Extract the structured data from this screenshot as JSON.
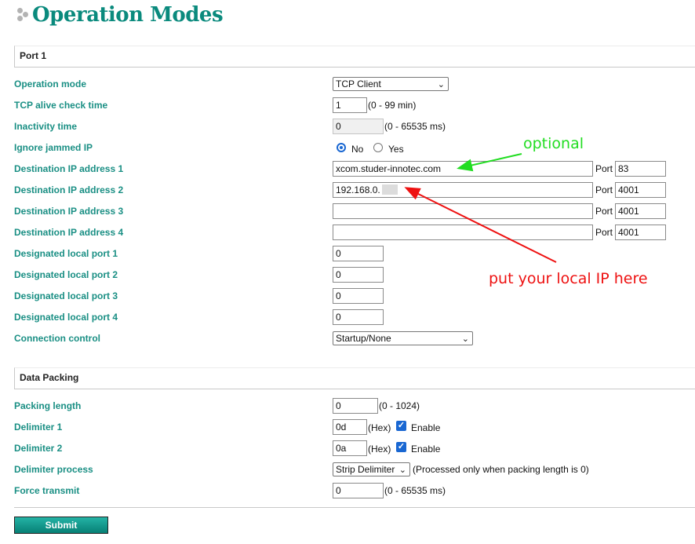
{
  "page": {
    "title": "Operation Modes"
  },
  "port_section": {
    "title": "Port 1",
    "rows": {
      "operation_mode": {
        "label": "Operation mode",
        "value": "TCP Client"
      },
      "tcp_alive": {
        "label": "TCP alive check time",
        "value": "1",
        "hint": "(0 - 99 min)"
      },
      "inactivity": {
        "label": "Inactivity time",
        "value": "0",
        "hint": "(0 - 65535 ms)"
      },
      "ignore_jammed": {
        "label": "Ignore jammed IP",
        "option_no": "No",
        "option_yes": "Yes",
        "selected": "No"
      },
      "dest1": {
        "label": "Destination IP address 1",
        "value": "xcom.studer-innotec.com",
        "port_label": "Port",
        "port": "83"
      },
      "dest2": {
        "label": "Destination IP address 2",
        "value": "192.168.0.",
        "port_label": "Port",
        "port": "4001"
      },
      "dest3": {
        "label": "Destination IP address 3",
        "value": "",
        "port_label": "Port",
        "port": "4001"
      },
      "dest4": {
        "label": "Destination IP address 4",
        "value": "",
        "port_label": "Port",
        "port": "4001"
      },
      "local1": {
        "label": "Designated local port 1",
        "value": "0"
      },
      "local2": {
        "label": "Designated local port 2",
        "value": "0"
      },
      "local3": {
        "label": "Designated local port 3",
        "value": "0"
      },
      "local4": {
        "label": "Designated local port 4",
        "value": "0"
      },
      "connection_control": {
        "label": "Connection control",
        "value": "Startup/None"
      }
    }
  },
  "packing_section": {
    "title": "Data Packing",
    "rows": {
      "packing_length": {
        "label": "Packing length",
        "value": "0",
        "hint": "(0 - 1024)"
      },
      "delim1": {
        "label": "Delimiter 1",
        "value": "0d",
        "hint": "(Hex)",
        "enable_label": "Enable",
        "enabled": true
      },
      "delim2": {
        "label": "Delimiter 2",
        "value": "0a",
        "hint": "(Hex)",
        "enable_label": "Enable",
        "enabled": true
      },
      "delim_process": {
        "label": "Delimiter process",
        "value": "Strip Delimiter",
        "hint": "(Processed only when packing length is 0)"
      },
      "force_transmit": {
        "label": "Force transmit",
        "value": "0",
        "hint": "(0 - 65535 ms)"
      }
    }
  },
  "submit": {
    "label": "Submit"
  },
  "annotations": {
    "optional": "optional",
    "local_ip": "put your local IP here"
  },
  "colors": {
    "title": "#0a8a7d",
    "label": "#1a8f84",
    "accent": "#1967d2",
    "annot_green": "#22dd22",
    "annot_red": "#ee1111"
  },
  "icons": {
    "title_bullet": "three-dots-icon",
    "select_arrow": "chevron-down-icon",
    "checkmark": "check-icon"
  }
}
